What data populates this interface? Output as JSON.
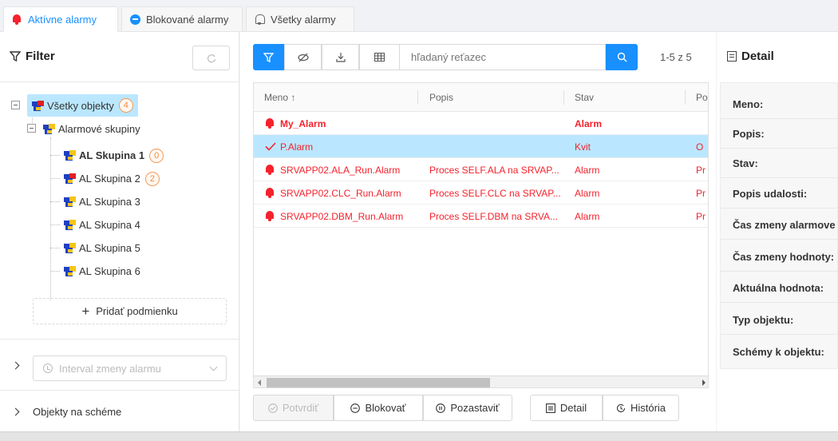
{
  "tabs": {
    "active": "Aktívne alarmy",
    "blocked": "Blokované alarmy",
    "all": "Všetky alarmy"
  },
  "filter": {
    "title": "Filter",
    "tree": {
      "root": {
        "label": "Všetky objekty",
        "count": "4"
      },
      "group": {
        "label": "Alarmové skupiny"
      },
      "items": [
        {
          "label": "AL Skupina 1",
          "count": "0"
        },
        {
          "label": "AL Skupina 2",
          "count": "2"
        },
        {
          "label": "AL Skupina 3"
        },
        {
          "label": "AL Skupina 4"
        },
        {
          "label": "AL Skupina 5"
        },
        {
          "label": "AL Skupina 6"
        }
      ]
    },
    "add_condition": "Pridať podmienku",
    "interval_placeholder": "Interval zmeny alarmu",
    "objects_on_scheme": "Objekty na schéme"
  },
  "toolbar": {
    "search_placeholder": "hľadaný reťazec",
    "count": "1-5 z 5"
  },
  "table": {
    "columns": {
      "name": "Meno ↑",
      "desc": "Popis",
      "state": "Stav",
      "extra": "Po"
    },
    "rows": [
      {
        "name": "My_Alarm",
        "desc": "",
        "state": "Alarm",
        "extra": ""
      },
      {
        "name": "P.Alarm",
        "desc": "",
        "state": "Kvit",
        "extra": "O"
      },
      {
        "name": "SRVAPP02.ALA_Run.Alarm",
        "desc": "Proces SELF.ALA na SRVAP...",
        "state": "Alarm",
        "extra": "Pr"
      },
      {
        "name": "SRVAPP02.CLC_Run.Alarm",
        "desc": "Proces SELF.CLC na SRVAP...",
        "state": "Alarm",
        "extra": "Pr"
      },
      {
        "name": "SRVAPP02.DBM_Run.Alarm",
        "desc": "Proces SELF.DBM na SRVA...",
        "state": "Alarm",
        "extra": "Pr"
      }
    ]
  },
  "actions": {
    "confirm": "Potvrdiť",
    "block": "Blokovať",
    "pause": "Pozastaviť",
    "detail": "Detail",
    "history": "História"
  },
  "detail": {
    "title": "Detail",
    "fields": [
      "Meno:",
      "Popis:",
      "Stav:",
      "Popis udalosti:",
      "Čas zmeny alarmove",
      "Čas zmeny hodnoty:",
      "Aktuálna hodnota:",
      "Typ objektu:",
      "Schémy k objektu:"
    ]
  },
  "colors": {
    "primary": "#1890ff",
    "alarm_red": "#f5222d",
    "badge_orange": "#f28c3c",
    "selected_row": "#bae7ff"
  }
}
